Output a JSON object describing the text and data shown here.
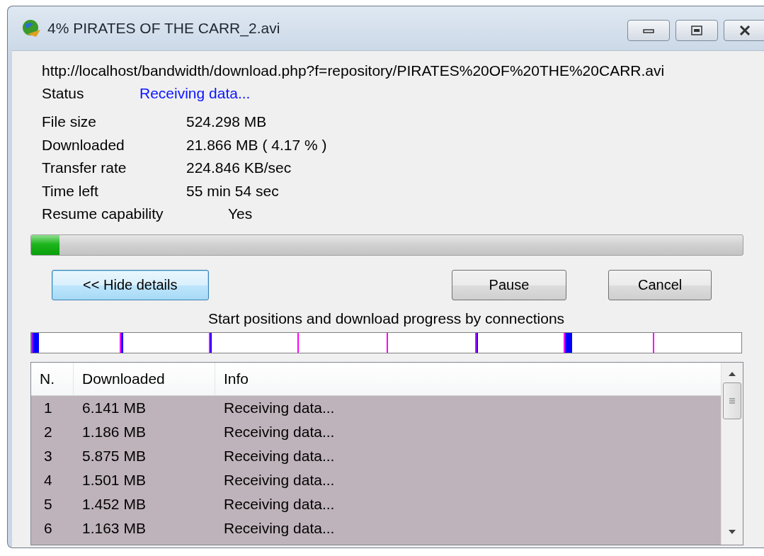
{
  "window": {
    "title": "4% PIRATES OF THE CARR_2.avi"
  },
  "url": "http://localhost/bandwidth/download.php?f=repository/PIRATES%20OF%20THE%20CARR.avi",
  "status": {
    "label": "Status",
    "value": "Receiving data..."
  },
  "details": [
    {
      "label": "File size",
      "value": "524.298  MB",
      "kind": "plain"
    },
    {
      "label": "Downloaded",
      "value": "21.866  MB  ( 4.17 % )",
      "kind": "plain"
    },
    {
      "label": "Transfer rate",
      "value": "224.846  KB/sec",
      "kind": "plain"
    },
    {
      "label": "Time left",
      "value": "55 min 54 sec",
      "kind": "plain"
    },
    {
      "label": "Resume capability",
      "value": "Yes",
      "kind": "indented"
    }
  ],
  "progress": {
    "level": 0.04
  },
  "buttons": [
    {
      "label": "<< Hide details",
      "focused": true
    },
    {
      "label": "Pause",
      "focused": false
    },
    {
      "label": "Cancel",
      "focused": false
    }
  ],
  "connections": {
    "caption": "Start positions and download progress by connections",
    "segments": [
      {
        "started": true,
        "level": 0.07
      },
      {
        "started": true,
        "level": 0.02
      },
      {
        "started": true,
        "level": 0.02
      },
      {
        "started": false
      },
      {
        "started": false
      },
      {
        "started": true,
        "level": 0.02
      },
      {
        "started": true,
        "level": 0.08
      },
      {
        "started": false
      }
    ]
  },
  "table": {
    "columns": [
      "N.",
      "Downloaded",
      "Info"
    ],
    "rows": [
      {
        "n": "1",
        "downloaded": "6.141  MB",
        "info": "Receiving data...",
        "selected": true
      },
      {
        "n": "2",
        "downloaded": "1.186  MB",
        "info": "Receiving data...",
        "selected": true
      },
      {
        "n": "3",
        "downloaded": "5.875  MB",
        "info": "Receiving data...",
        "selected": true
      },
      {
        "n": "4",
        "downloaded": "1.501  MB",
        "info": "Receiving data...",
        "selected": true
      },
      {
        "n": "5",
        "downloaded": "1.452  MB",
        "info": "Receiving data...",
        "selected": true
      },
      {
        "n": "6",
        "downloaded": "1.163  MB",
        "info": "Receiving data...",
        "selected": true
      }
    ]
  }
}
